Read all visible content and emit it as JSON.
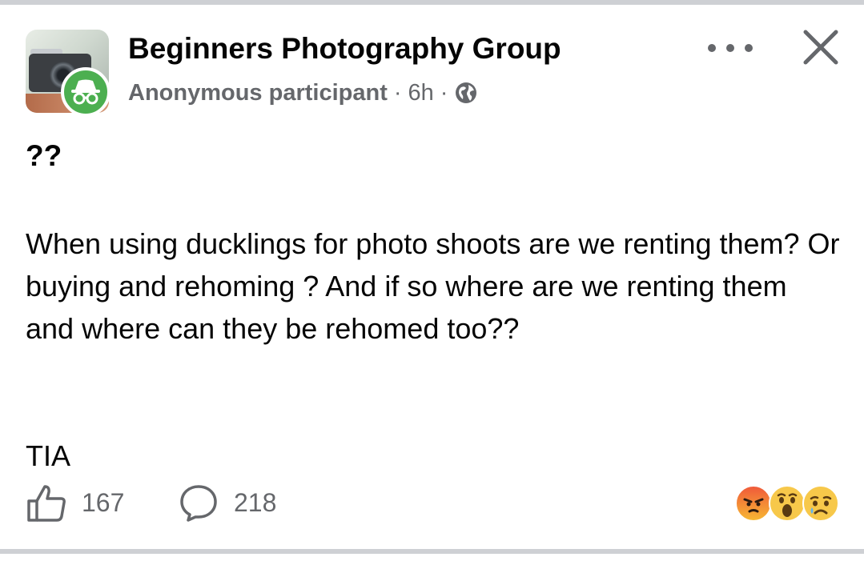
{
  "post": {
    "group_name": "Beginners Photography Group",
    "author": "Anonymous participant",
    "separator": "·",
    "time": "6h",
    "privacy_icon": "globe-icon",
    "headline": "??",
    "body": "When using ducklings for photo shoots are we renting them? Or buying and rehoming ? And if so where are we renting them and where can they be rehomed too??",
    "sign_off": "TIA"
  },
  "footer": {
    "likes_count": "167",
    "comments_count": "218",
    "reactions": [
      "angry",
      "wow",
      "sad"
    ]
  },
  "icons": {
    "more": "more-options-icon",
    "close": "close-icon",
    "like": "thumbs-up-icon",
    "comment": "comment-bubble-icon",
    "anonymous": "incognito-icon"
  },
  "colors": {
    "text_primary": "#050505",
    "text_secondary": "#65676b",
    "divider": "#ced0d4",
    "anonymous_badge": "#4caf50"
  }
}
